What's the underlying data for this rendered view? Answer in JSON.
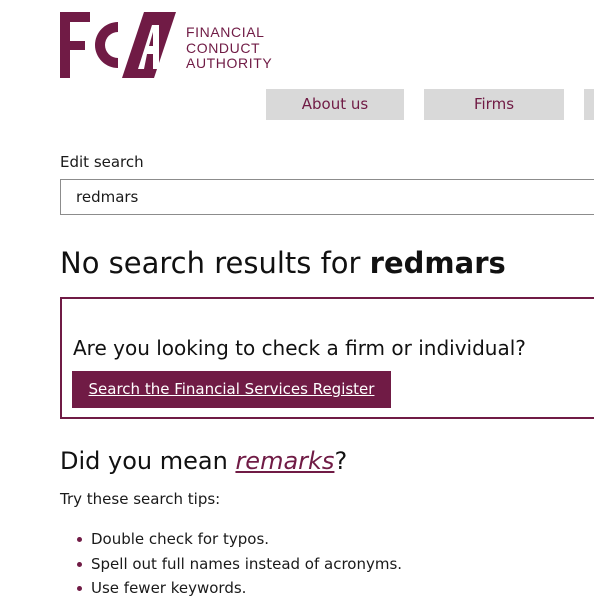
{
  "brand": {
    "logo_letters": "FCA",
    "name_lines": [
      "FINANCIAL",
      "CONDUCT",
      "AUTHORITY"
    ],
    "color": "#701b45"
  },
  "nav": {
    "items": [
      {
        "label": "About us"
      },
      {
        "label": "Firms"
      },
      {
        "label": ""
      }
    ],
    "background": "#d9d9d9"
  },
  "search": {
    "label": "Edit search",
    "value": "redmars"
  },
  "results": {
    "heading_prefix": "No search results for ",
    "query": "redmars"
  },
  "callout": {
    "question": "Are you looking to check a firm or individual?",
    "button_label": "Search the Financial Services Register"
  },
  "suggestion": {
    "prefix": "Did you mean ",
    "term": "remarks",
    "suffix": "?"
  },
  "tips": {
    "intro": "Try these search tips:",
    "items": [
      "Double check for typos.",
      "Spell out full names instead of acronyms.",
      "Use fewer keywords."
    ]
  }
}
